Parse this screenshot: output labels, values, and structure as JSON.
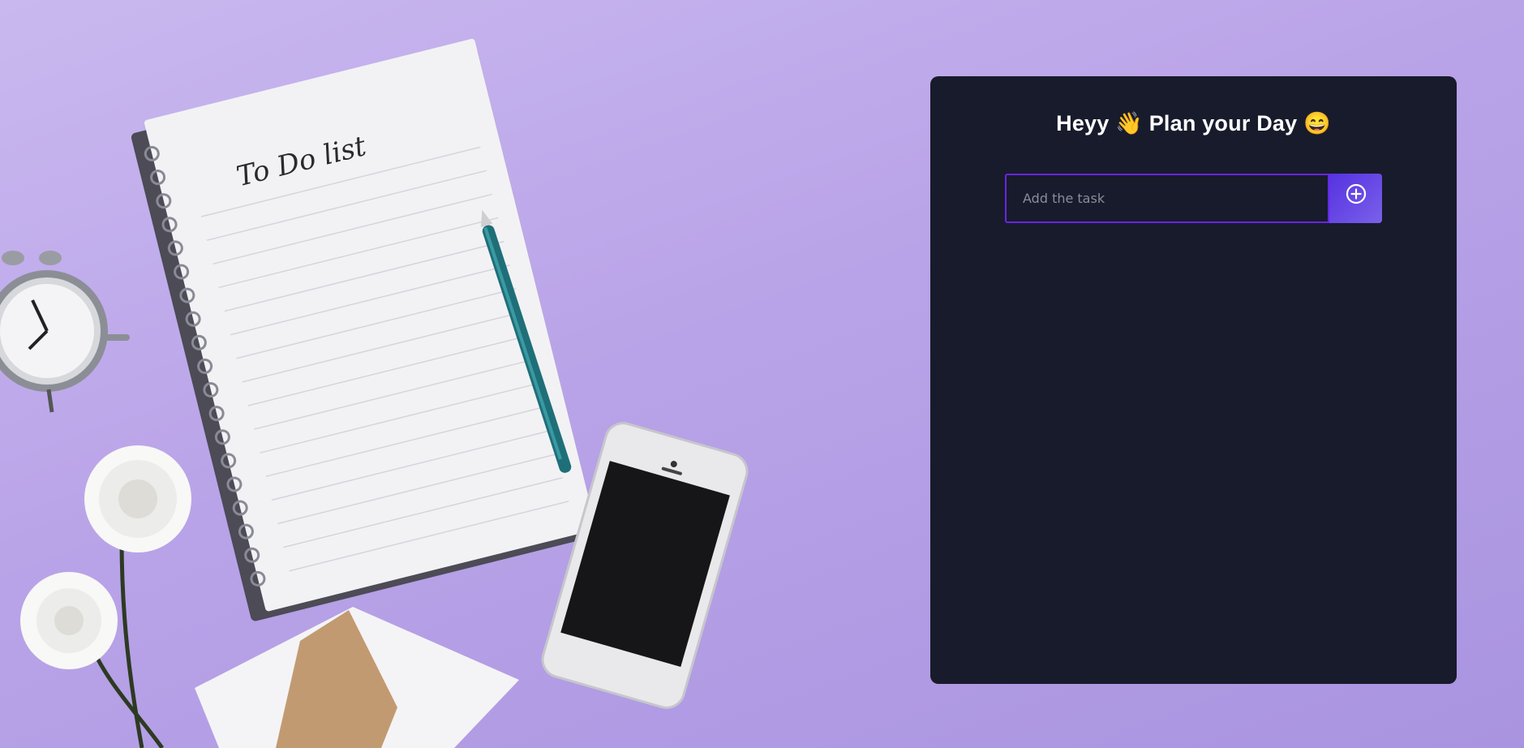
{
  "background": {
    "notebook_heading": "To Do list",
    "color": "#bca8ea"
  },
  "panel": {
    "background_color": "#181b2b",
    "title": "Heyy 👋 Plan your Day 😄",
    "input": {
      "value": "",
      "placeholder": "Add the task",
      "border_color": "#6a24e6"
    },
    "add_button": {
      "icon": "plus-circle-icon",
      "color": "#5a3be2"
    }
  }
}
